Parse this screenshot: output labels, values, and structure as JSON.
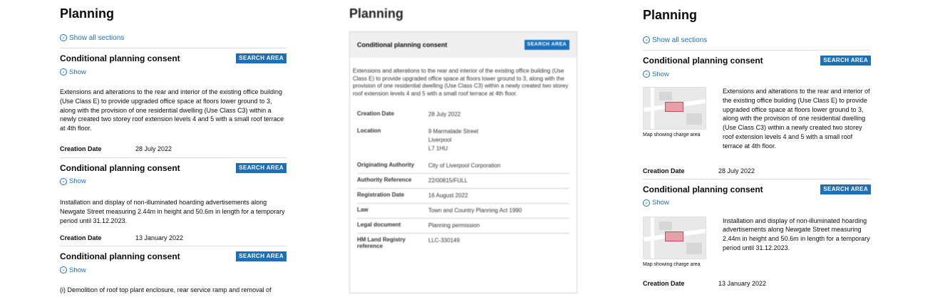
{
  "left": {
    "title": "Planning",
    "show_all": "Show all sections",
    "sections": [
      {
        "title": "Conditional planning consent",
        "badge": "SEARCH AREA",
        "show": "Show",
        "description": "Extensions and alterations to the rear and interior of the existing office building (Use Class E) to provide upgraded office space at floors lower ground to 3, along with the provision of one residential dwelling (Use Class C3) within a newly created two storey roof extension levels 4 and 5 with a small roof terrace at 4th floor.",
        "date_label": "Creation Date",
        "date_value": "28 July 2022"
      },
      {
        "title": "Conditional planning consent",
        "badge": "SEARCH AREA",
        "show": "Show",
        "description": "Installation and display of non-illuminated hoarding advertisements along Newgate Street measuring 2.44m in height and 50.6m in length for a temporary period until 31.12.2023.",
        "date_label": "Creation Date",
        "date_value": "13 January 2022"
      },
      {
        "title": "Conditional planning consent",
        "badge": "SEARCH AREA",
        "show": "Show",
        "description": "(i) Demolition of roof top plant enclosure, rear service ramp and removal of"
      }
    ]
  },
  "middle": {
    "title": "Planning",
    "section_title": "Conditional planning consent",
    "badge": "SEARCH AREA",
    "description": "Extensions and alterations to the rear and interior of the existing office building (Use Class E) to provide upgraded office space at floors lower ground to 3, along with the provision of one residential dwelling (Use Class C3) within a newly created two storey roof extension levels 4 and 5 with a small roof terrace at 4th floor.",
    "rows": [
      {
        "label": "Creation Date",
        "value": "28 July 2022"
      },
      {
        "label": "Location",
        "value": "9 Marmalade Street\nLiverpool\nL7 1HU"
      },
      {
        "label": "Originating Authority",
        "value": "City of Liverpool Corporation"
      },
      {
        "label": "Authority Reference",
        "value": "22/00815/FULL"
      },
      {
        "label": "Registration Date",
        "value": "16 August 2022"
      },
      {
        "label": "Law",
        "value": "Town and Country Planning Act 1990"
      },
      {
        "label": "Legal document",
        "value": "Planning permission"
      },
      {
        "label": "HM Land Registry reference",
        "value": "LLC-330149"
      }
    ]
  },
  "right": {
    "title": "Planning",
    "show_all": "Show all sections",
    "map_caption": "Map showing charge area",
    "sections": [
      {
        "title": "Conditional planning consent",
        "badge": "SEARCH AREA",
        "show": "Show",
        "description": "Extensions and alterations to the rear and interior of the existing office building (Use Class E) to provide upgraded office space at floors lower ground to 3, along with the provision of one residential dwelling (Use Class C3) within a newly created two storey roof extension levels 4 and 5 with a small roof terrace at 4th floor.",
        "date_label": "Creation Date",
        "date_value": "28 July 2022"
      },
      {
        "title": "Conditional planning consent",
        "badge": "SEARCH AREA",
        "show": "Show",
        "description": "Installation and display of non-illuminated hoarding advertisements along Newgate Street measuring 2.44m in height and 50.6m in length for a temporary period until 31.12.2023.",
        "date_label": "Creation Date",
        "date_value": "13 January 2022"
      }
    ]
  },
  "icons": {
    "chevron": "chevron-down-circle-icon"
  },
  "colors": {
    "link": "#1d70b8",
    "badge_bg": "#1d70b8",
    "text": "#0b0c0c",
    "charge_area": "#e8a0a8"
  }
}
